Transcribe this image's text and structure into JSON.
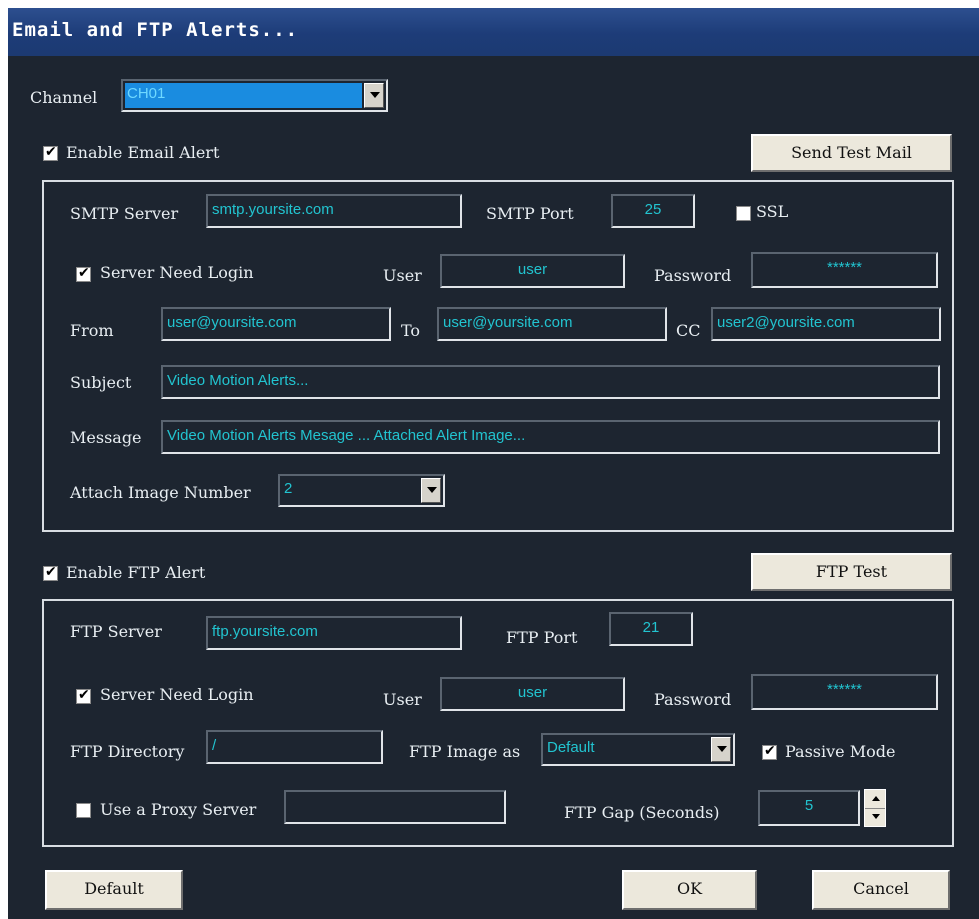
{
  "window": {
    "title": "Email and FTP Alerts..."
  },
  "channel": {
    "label": "Channel",
    "value": "CH01"
  },
  "email": {
    "enable_label": "Enable Email Alert",
    "enabled": true,
    "test_button": "Send Test Mail",
    "smtp_server_label": "SMTP Server",
    "smtp_server_value": "smtp.yoursite.com",
    "smtp_port_label": "SMTP Port",
    "smtp_port_value": "25",
    "ssl_label": "SSL",
    "ssl_checked": false,
    "login_label": "Server Need Login",
    "login_checked": true,
    "user_label": "User",
    "user_value": "user",
    "password_label": "Password",
    "password_value": "******",
    "from_label": "From",
    "from_value": "user@yoursite.com",
    "to_label": "To",
    "to_value": "user@yoursite.com",
    "cc_label": "CC",
    "cc_value": "user2@yoursite.com",
    "subject_label": "Subject",
    "subject_value": "Video Motion Alerts...",
    "message_label": "Message",
    "message_value": "Video Motion Alerts Mesage ... Attached Alert Image...",
    "attach_label": "Attach Image Number",
    "attach_value": "2"
  },
  "ftp": {
    "enable_label": "Enable FTP Alert",
    "enabled": true,
    "test_button": "FTP Test",
    "server_label": "FTP Server",
    "server_value": "ftp.yoursite.com",
    "port_label": "FTP Port",
    "port_value": "21",
    "login_label": "Server Need Login",
    "login_checked": true,
    "user_label": "User",
    "user_value": "user",
    "password_label": "Password",
    "password_value": "******",
    "directory_label": "FTP Directory",
    "directory_value": "/",
    "image_as_label": "FTP Image as",
    "image_as_value": "Default",
    "passive_label": "Passive Mode",
    "passive_checked": true,
    "proxy_label": "Use a Proxy Server",
    "proxy_checked": false,
    "proxy_value": "",
    "gap_label": "FTP Gap (Seconds)",
    "gap_value": "5"
  },
  "buttons": {
    "default": "Default",
    "ok": "OK",
    "cancel": "Cancel"
  },
  "colors": {
    "background": "#1d2530",
    "titlebar": "#1d3c78",
    "field_text": "#22c4d0",
    "button_face": "#ece8dc"
  }
}
